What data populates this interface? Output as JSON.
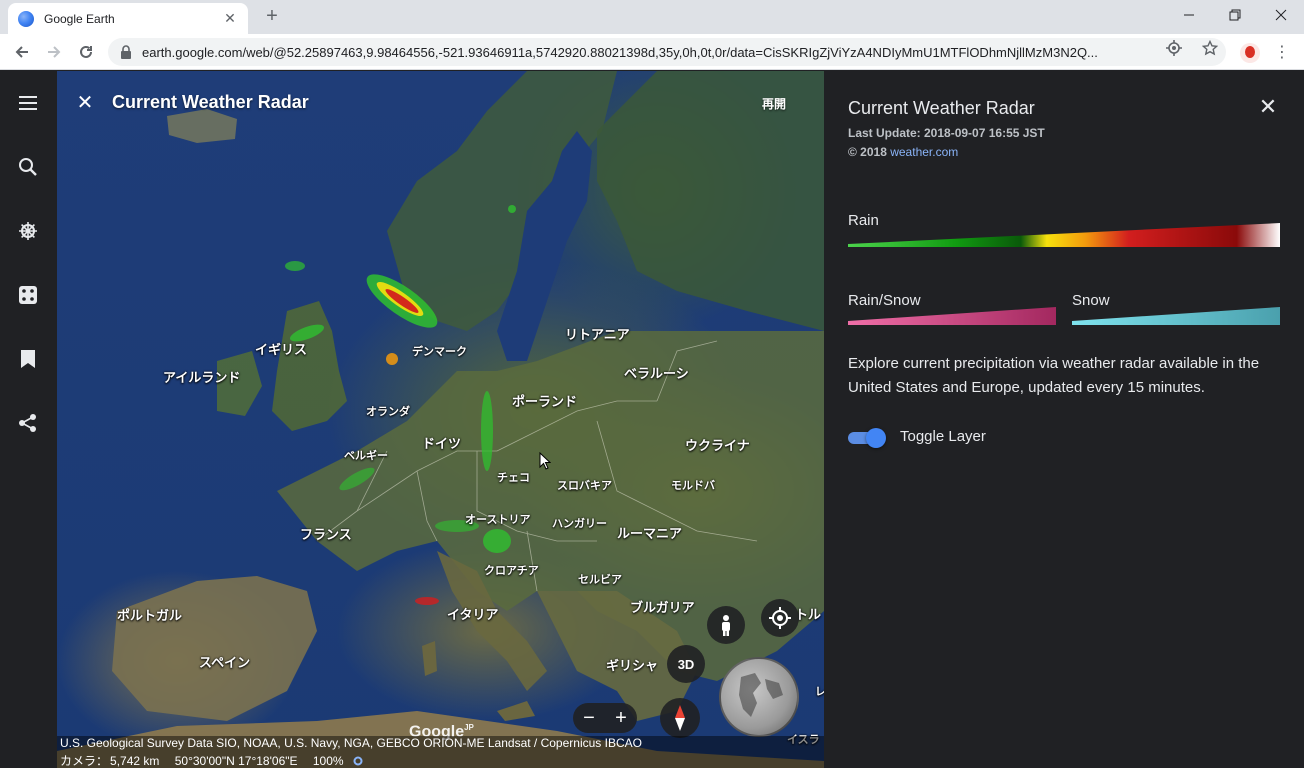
{
  "browser": {
    "tab_title": "Google Earth",
    "tab_close": "✕",
    "new_tab": "+",
    "url": "earth.google.com/web/@52.25897463,9.98464556,-521.93646911a,5742920.88021398d,35y,0h,0t,0r/data=CisSKRIgZjViYzA4NDIyMmU1MTFlODhmNjllMzM3N2Q..."
  },
  "map": {
    "title": "Current Weather Radar",
    "replay": "再開",
    "labels": {
      "iceland_area": "",
      "ireland": "アイルランド",
      "uk": "イギリス",
      "denmark": "デンマーク",
      "lithuania": "リトアニア",
      "belarus": "ベラルーシ",
      "netherlands": "オランダ",
      "poland": "ポーランド",
      "germany": "ドイツ",
      "belgium": "ベルギー",
      "ukraine": "ウクライナ",
      "czech": "チェコ",
      "slovakia": "スロバキア",
      "moldova": "モルドバ",
      "austria": "オーストリア",
      "hungary": "ハンガリー",
      "romania": "ルーマニア",
      "france": "フランス",
      "croatia": "クロアチア",
      "serbia": "セルビア",
      "portugal": "ポルトガル",
      "italy": "イタリア",
      "bulgaria": "ブルガリア",
      "spain": "スペイン",
      "greece": "ギリシャ",
      "turkey_part": "トル",
      "israel_part": "イスラ",
      "lebanon_part": "レ"
    },
    "controls": {
      "mode_3d": "3D",
      "zoom_out": "−",
      "zoom_in": "+"
    },
    "watermark": "Google",
    "watermark_sup": "JP",
    "attribution_line1": "U.S. Geological Survey  Data SIO, NOAA, U.S. Navy, NGA, GEBCO  ORION-ME  Landsat / Copernicus  IBCAO",
    "camera_label": "カメラ：",
    "camera_value": "5,742 km",
    "coordinates": "50°30'00\"N 17°18'06\"E",
    "zoom_percent": "100%"
  },
  "panel": {
    "title": "Current Weather Radar",
    "last_update": "Last Update: 2018-09-07 16:55 JST",
    "copyright": "© 2018",
    "copyright_link": "weather.com",
    "rain_label": "Rain",
    "rain_snow_label": "Rain/Snow",
    "snow_label": "Snow",
    "description": "Explore current precipitation via weather radar available in the United States and Europe, updated every 15 minutes.",
    "toggle_label": "Toggle Layer",
    "toggle_on": true
  },
  "colors": {
    "rain_ramp": [
      "#4cd34c",
      "#0a8a0a",
      "#0a5a0a",
      "#f6e10d",
      "#f39a0d",
      "#d21e1e",
      "#8a0a0a",
      "#ffffff"
    ],
    "rain_snow_ramp": [
      "#f06fa8",
      "#a3285f"
    ],
    "snow_ramp": [
      "#7fe3ee",
      "#4aa0ad"
    ],
    "accent": "#4285f4"
  }
}
